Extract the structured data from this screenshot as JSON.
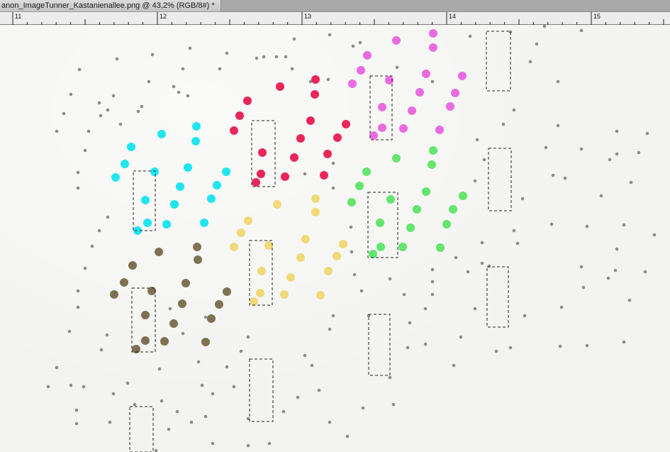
{
  "document": {
    "tab_title": "anon_ImageTunner_Kastanienallee.png @ 43,2% (RGB/8#) *"
  },
  "ruler": {
    "labels": [
      "11",
      "12",
      "13",
      "14",
      "15"
    ]
  },
  "artwork": {
    "colors": {
      "cyan": "#1fe6ee",
      "red": "#e8265a",
      "magenta": "#ea6be0",
      "green": "#63e56e",
      "yellow": "#f0da78",
      "olive": "#7e7152",
      "gray": "#8c8c8c",
      "frame": "#222222"
    }
  }
}
